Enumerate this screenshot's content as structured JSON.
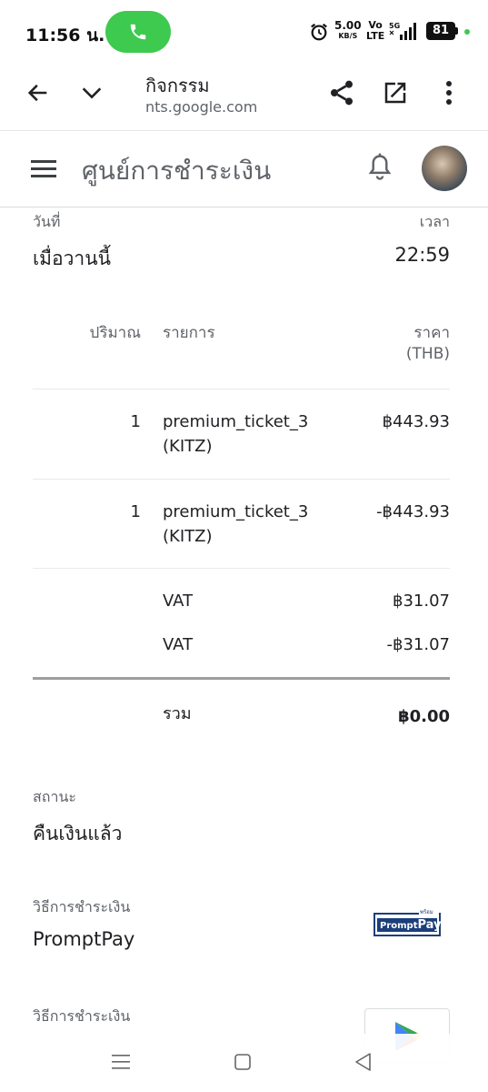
{
  "status_bar": {
    "time": "11:56 น.",
    "speed_value": "5.00",
    "speed_unit": "KB/S",
    "volte_top": "Vo",
    "volte_bottom": "LTE",
    "battery": "81",
    "icons": [
      "phone-call-icon",
      "alarm-icon",
      "signal-5g-icon",
      "battery-icon"
    ],
    "call_color": "#3ec94f"
  },
  "browser": {
    "title": "กิจกรรม",
    "url": "nts.google.com",
    "icons": [
      "back-arrow-icon",
      "chevron-down-icon",
      "share-icon",
      "open-external-icon",
      "more-vert-icon"
    ]
  },
  "app_header": {
    "title": "ศูนย์การชำระเงิน",
    "icons": [
      "menu-icon",
      "bell-icon",
      "avatar"
    ]
  },
  "transaction": {
    "date_label": "วันที่",
    "date_value": "เมื่อวานนี้",
    "time_label": "เวลา",
    "time_value": "22:59",
    "table": {
      "headers": {
        "quantity": "ปริมาณ",
        "item": "รายการ",
        "price_line1": "ราคา",
        "price_line2": "(THB)"
      },
      "rows": [
        {
          "qty": "1",
          "item_line1": "premium_ticket_3",
          "item_line2": "(KITZ)",
          "price": "฿443.93"
        },
        {
          "qty": "1",
          "item_line1": "premium_ticket_3",
          "item_line2": "(KITZ)",
          "price": "-฿443.93"
        }
      ],
      "vat_rows": [
        {
          "label": "VAT",
          "price": "฿31.07"
        },
        {
          "label": "VAT",
          "price": "-฿31.07"
        }
      ],
      "total_label": "รวม",
      "total_value": "฿0.00"
    },
    "status_label": "สถานะ",
    "status_value": "คืนเงินแล้ว",
    "payment_method_label": "วิธีการชำระเงิน",
    "payment_method_value": "PromptPay",
    "promptpay_logo": {
      "prompt": "Prompt",
      "pay": "Pay",
      "top": "พร้อมเพย์"
    },
    "payment_method_label_2": "วิธีการชำระเงิน",
    "payment_icon_2": "google-play-icon"
  },
  "nav_bar": {
    "icons": [
      "recent-apps-icon",
      "home-icon",
      "back-icon"
    ]
  }
}
